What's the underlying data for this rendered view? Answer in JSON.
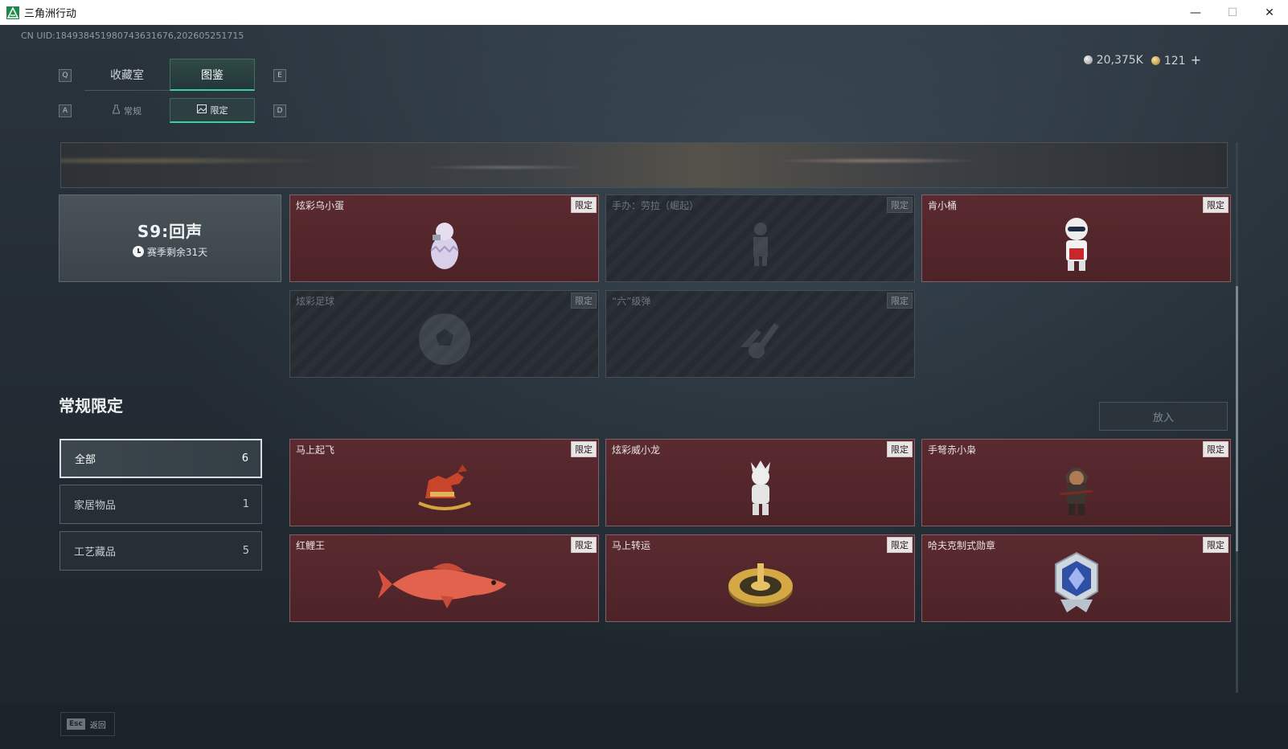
{
  "window": {
    "title": "三角洲行动",
    "controls": {
      "minimize": "—",
      "maximize": "☐",
      "close": "✕"
    }
  },
  "uid_text": "CN UID:18493845198074363167​6,202605251715",
  "currency": {
    "silver": "20,375K",
    "gold": "121",
    "add": "+"
  },
  "tabs": {
    "prev_key": "Q",
    "next_key": "E",
    "items": [
      {
        "label": "收藏室",
        "active": false
      },
      {
        "label": "图鉴",
        "active": true
      }
    ]
  },
  "subtabs": {
    "prev_key": "A",
    "next_key": "D",
    "items": [
      {
        "label": "常规",
        "icon": "flask-icon",
        "active": false
      },
      {
        "label": "限定",
        "icon": "picture-icon",
        "active": true
      }
    ]
  },
  "season": {
    "title": "S9:回声",
    "remaining": "赛季剩余31天"
  },
  "badge_label": "限定",
  "season_items": [
    {
      "name": "炫彩乌小蛋",
      "locked": false,
      "icon": "egg-figure-icon"
    },
    {
      "name": "手办：劳拉（崛起）",
      "locked": true,
      "icon": "figure-icon"
    },
    {
      "name": "肯小桶",
      "locked": false,
      "icon": "chibi-figure-icon"
    },
    {
      "name": "炫彩足球",
      "locked": true,
      "icon": "football-icon"
    },
    {
      "name": "“六”级弹",
      "locked": true,
      "icon": "hand-icon"
    }
  ],
  "section": {
    "title": "常规限定",
    "put_in_button": "放入"
  },
  "filters": [
    {
      "label": "全部",
      "count": "6",
      "active": true
    },
    {
      "label": "家居物品",
      "count": "1",
      "active": false
    },
    {
      "label": "工艺藏品",
      "count": "5",
      "active": false
    }
  ],
  "regular_items": [
    {
      "name": "马上起飞",
      "icon": "rocking-horse-icon"
    },
    {
      "name": "炫彩威小龙",
      "icon": "white-dragon-figure-icon"
    },
    {
      "name": "手弩赤小枭",
      "icon": "crossbow-figure-icon"
    },
    {
      "name": "红鲤王",
      "icon": "red-carp-icon"
    },
    {
      "name": "马上转运",
      "icon": "gold-wheel-icon"
    },
    {
      "name": "哈夫克制式勋章",
      "icon": "medal-icon"
    }
  ],
  "bottom": {
    "esc_key": "Esc",
    "back_label": "返回"
  },
  "colors": {
    "accent": "#36d3a0",
    "card_owned": "#5a2a2f",
    "card_locked": "#2a3036",
    "background": "#232c34"
  }
}
